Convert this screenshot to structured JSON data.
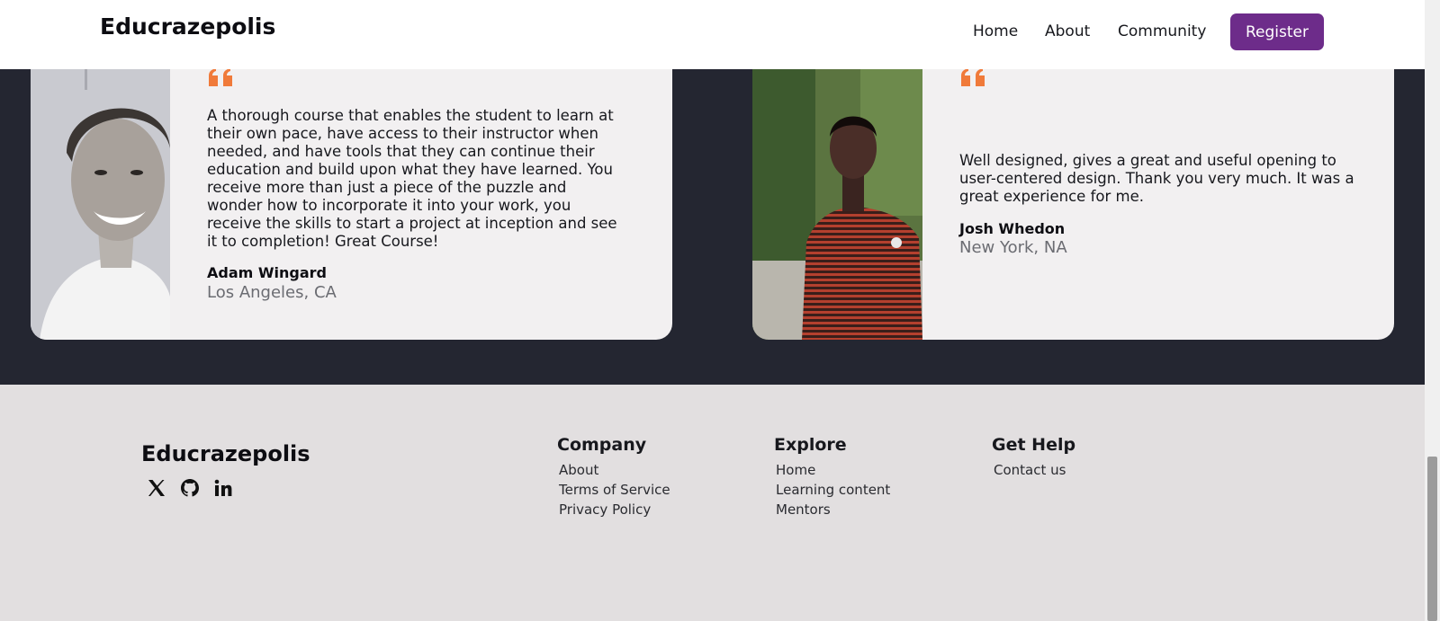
{
  "header": {
    "logo": "Educrazepolis",
    "nav": [
      "Home",
      "About",
      "Community"
    ],
    "register_label": "Register",
    "accent_color": "#6d2c8a"
  },
  "testimonials": [
    {
      "quote": "A thorough course that enables the student to learn at their own pace, have access to their instructor when needed, and have tools that they can continue their education and build upon what they have learned. You receive more than just a piece of the puzzle and wonder how to incorporate it into your work, you receive the skills to start a project at inception and see it to completion! Great Course!",
      "name": "Adam Wingard",
      "location": "Los Angeles, CA"
    },
    {
      "quote": "Well designed, gives a great and useful opening to user-centered design. Thank you very much. It was a great experience for me.",
      "name": "Josh Whedon",
      "location": "New York, NA"
    }
  ],
  "quote_color": "#f07a3a",
  "footer": {
    "logo": "Educrazepolis",
    "social": [
      "x-icon",
      "github-icon",
      "linkedin-icon"
    ],
    "columns": [
      {
        "title": "Company",
        "links": [
          "About",
          "Terms of Service",
          "Privacy Policy"
        ]
      },
      {
        "title": "Explore",
        "links": [
          "Home",
          "Learning content",
          "Mentors"
        ]
      },
      {
        "title": "Get Help",
        "links": [
          "Contact us"
        ]
      }
    ]
  }
}
